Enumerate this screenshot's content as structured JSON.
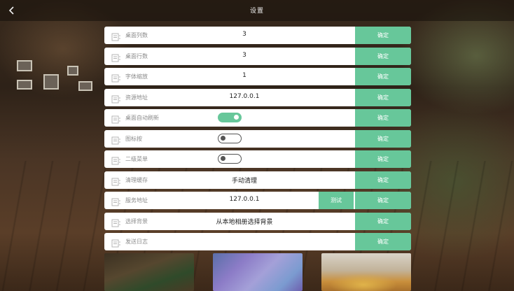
{
  "header": {
    "title": "设置",
    "back_icon": "chevron-left-icon"
  },
  "rows": [
    {
      "label": "桌面列数",
      "value": "3",
      "ok": "确定"
    },
    {
      "label": "桌面行数",
      "value": "3",
      "ok": "确定"
    },
    {
      "label": "字体缩放",
      "value": "1",
      "ok": "确定"
    },
    {
      "label": "资源地址",
      "value": "127.0.0.1",
      "ok": "确定"
    },
    {
      "label": "桌面自动刷新",
      "toggle": true,
      "ok": "确定"
    },
    {
      "label": "图标按",
      "toggle": false,
      "ok": "确定"
    },
    {
      "label": "二级菜单",
      "toggle": false,
      "ok": "确定"
    },
    {
      "label": "清理缓存",
      "value": "手动清理",
      "ok": "确定"
    },
    {
      "label": "服务地址",
      "value": "127.0.0.1",
      "test": "测试",
      "ok": "确定"
    },
    {
      "label": "选择背景",
      "value": "从本地相册选择背景",
      "ok": "确定"
    },
    {
      "label": "发送日志",
      "ok": "确定"
    }
  ],
  "colors": {
    "accent": "#67c79a",
    "row_bg": "#ffffff",
    "label": "#8b8b8b"
  }
}
